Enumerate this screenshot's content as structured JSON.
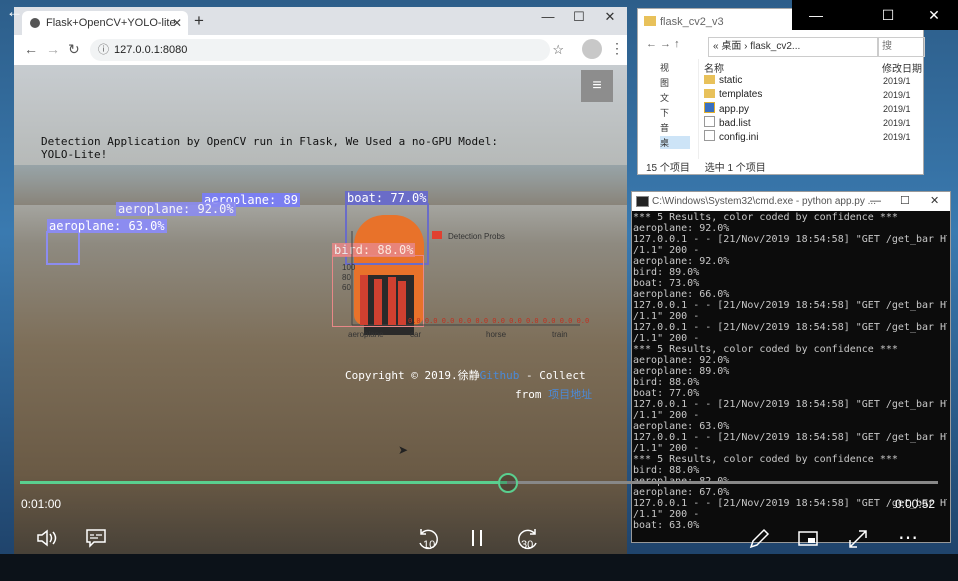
{
  "browser": {
    "tab_title": "Flask+OpenCV+YOLO-lite",
    "tab_close": "✕",
    "new_tab": "+",
    "url": "127.0.0.1:8080",
    "window_controls": [
      "—",
      "☐",
      "✕"
    ]
  },
  "page": {
    "detection_text": "Detection Application by OpenCV run in Flask, We Used a no-GPU Model: YOLO-Lite!",
    "menu_icon": "≡",
    "labels": [
      {
        "text": "aeroplane: 89",
        "color": "#7b7ff0"
      },
      {
        "text": "boat: 77.0%",
        "color": "#6a6cc8"
      },
      {
        "text": "aeroplane: 92.0%",
        "color": "#8c8cf0"
      },
      {
        "text": "aeroplane: 63.0%",
        "color": "#8c8cf0"
      },
      {
        "text": "bird: 88.0%",
        "color": "#e88888"
      }
    ],
    "chart_title": "Detection Probs",
    "chart_ylabels": [
      "100",
      "80",
      "60"
    ],
    "chart_xlabels": [
      "aeroplane",
      "car",
      "horse",
      "train"
    ],
    "chart_zero_values": "0.0 0.0 0.0 0.0 0.0 0.0 0.0 0.0 0.0 0.0 0.0 0.0 0.0 0.0",
    "copyright_prefix": "Copyright © 2019.徐静",
    "copyright_link": "Github",
    "copyright_suffix": " - Collect",
    "from_prefix": "from ",
    "from_link": "项目地址"
  },
  "explorer": {
    "title": "flask_cv2_v3",
    "breadcrumb": "« 桌面 › flask_cv2...",
    "search_placeholder": "搜索\"flas...",
    "col_name": "名称",
    "col_date": "修改日期",
    "nav_items": [
      "视",
      "图",
      "文",
      "下",
      "音",
      "桌"
    ],
    "files": [
      {
        "name": "static",
        "type": "folder",
        "date": "2019/1"
      },
      {
        "name": "templates",
        "type": "folder",
        "date": "2019/1"
      },
      {
        "name": "app.py",
        "type": "py",
        "date": "2019/1"
      },
      {
        "name": "bad.list",
        "type": "file",
        "date": "2019/1"
      },
      {
        "name": "config.ini",
        "type": "file",
        "date": "2019/1"
      }
    ],
    "status_count": "15 个项目",
    "status_selected": "选中 1 个项目"
  },
  "cmd": {
    "title": "C:\\Windows\\System32\\cmd.exe - python  app.py ...",
    "lines": [
      "*** 5 Results, color coded by confidence ***",
      "aeroplane: 92.0%",
      "127.0.0.1 - - [21/Nov/2019 18:54:58] \"GET /get_bar HTTP",
      "/1.1\" 200 -",
      "aeroplane: 92.0%",
      "bird: 89.0%",
      "boat: 73.0%",
      "aeroplane: 66.0%",
      "127.0.0.1 - - [21/Nov/2019 18:54:58] \"GET /get_bar HTTP",
      "/1.1\" 200 -",
      "127.0.0.1 - - [21/Nov/2019 18:54:58] \"GET /get_bar HTTP",
      "/1.1\" 200 -",
      "*** 5 Results, color coded by confidence ***",
      "aeroplane: 92.0%",
      "aeroplane: 89.0%",
      "bird: 88.0%",
      "boat: 77.0%",
      "127.0.0.1 - - [21/Nov/2019 18:54:58] \"GET /get_bar HTTP",
      "/1.1\" 200 -",
      "aeroplane: 63.0%",
      "127.0.0.1 - - [21/Nov/2019 18:54:58] \"GET /get_bar HTTP",
      "/1.1\" 200 -",
      "*** 5 Results, color coded by confidence ***",
      "bird: 88.0%",
      "aeroplane: 82.0%",
      "aeroplane: 67.0%",
      "127.0.0.1 - - [21/Nov/2019 18:54:58] \"GET /get_bar HTTP",
      "/1.1\" 200 -",
      "boat: 63.0%"
    ]
  },
  "player": {
    "current_time": "0:01:00",
    "remaining_time": "0:00:52",
    "progress": 0.53,
    "skip_back": "10",
    "skip_forward": "30"
  }
}
